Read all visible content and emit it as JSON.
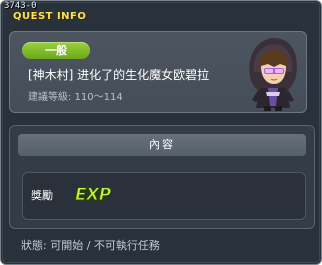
{
  "title_bar": {
    "quest_id": "3743-0",
    "title": "QUEST INFO"
  },
  "quest": {
    "category_badge": "一般",
    "name": "[神木村] 进化了的生化魔女欧碧拉",
    "level_requirement": "建議等級: 110～114"
  },
  "content": {
    "header": "內容",
    "reward_label": "獎勵",
    "reward_icon_text": "EXP"
  },
  "status": "狀態: 可開始 / 不可執行任務",
  "colors": {
    "title": "#ffe14a",
    "badge": "#7cbb26",
    "exp": "#c8f23a",
    "window_bg": "#29313b"
  },
  "icons": [
    "npc-portrait-icon",
    "exp-icon"
  ]
}
